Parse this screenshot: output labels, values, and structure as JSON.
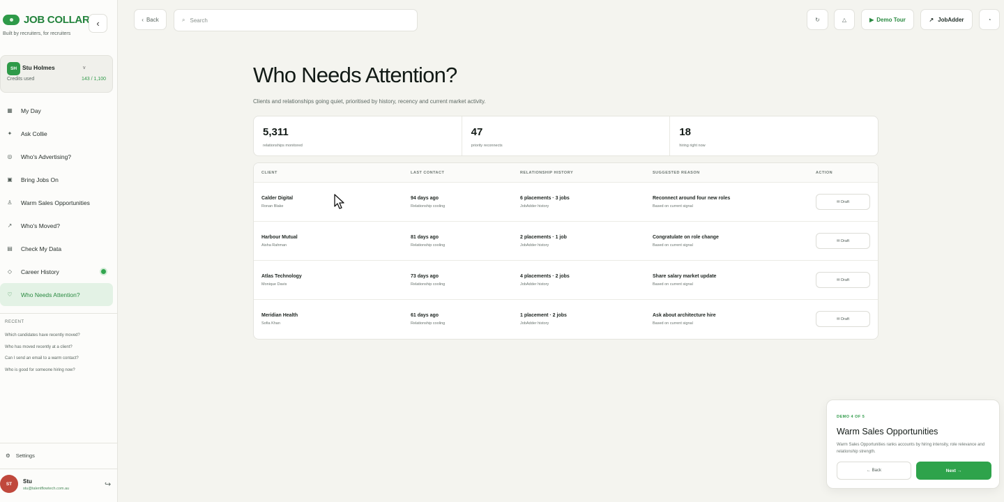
{
  "brand": {
    "name": "JOB COLLAR",
    "tagline": "Built by recruiters, for recruiters",
    "accent": "#2e9a48"
  },
  "user_card": {
    "initials": "SH",
    "name": "Stu Holmes",
    "credits_label": "Credits used",
    "credits_value": "143 / 1,100"
  },
  "sidebar": {
    "items": [
      {
        "label": "My Day",
        "icon": "grid-icon"
      },
      {
        "label": "Ask Collie",
        "icon": "sparkle-icon"
      },
      {
        "label": "Who's Advertising?",
        "icon": "target-icon"
      },
      {
        "label": "Bring Jobs On",
        "icon": "square-icon"
      },
      {
        "label": "Warm Sales Opportunities",
        "icon": "person-icon"
      },
      {
        "label": "Who's Moved?",
        "icon": "arrow-icon"
      },
      {
        "label": "Check My Data",
        "icon": "table-icon"
      },
      {
        "label": "Career History",
        "icon": "diamond-icon"
      },
      {
        "label": "Who Needs Attention?",
        "icon": "heart-icon"
      }
    ],
    "recent_title": "RECENT",
    "recent": [
      "Which candidates have recently moved?",
      "Who has moved recently at a client?",
      "Can I send an email to a warm contact?",
      "Who is good for someone hiring now?"
    ],
    "settings_label": "Settings"
  },
  "profile": {
    "initials": "ST",
    "name": "Stu",
    "email": "stu@talentflowtech.com.au"
  },
  "topbar": {
    "back_label": "Back",
    "search_placeholder": "Search",
    "demo_tour_label": "Demo Tour",
    "jobadder_label": "JobAdder"
  },
  "page": {
    "title": "Who Needs Attention?",
    "subtitle": "Clients and relationships going quiet, prioritised by history, recency and current market activity."
  },
  "stats": [
    {
      "value": "5,311",
      "label": "relationships monitored"
    },
    {
      "value": "47",
      "label": "priority reconnects"
    },
    {
      "value": "18",
      "label": "hiring right now"
    }
  ],
  "table": {
    "headers": [
      "CLIENT",
      "LAST CONTACT",
      "RELATIONSHIP HISTORY",
      "SUGGESTED REASON",
      "ACTION"
    ],
    "rows": [
      {
        "client": "Calder Digital",
        "contact": "Ronan Blake",
        "last": "94 days ago",
        "last_sub": "Relationship cooling",
        "history": "6 placements · 3 jobs",
        "history_sub": "JobAdder history",
        "reason": "Reconnect around four new roles",
        "reason_sub": "Based on current signal",
        "action": "Draft"
      },
      {
        "client": "Harbour Mutual",
        "contact": "Aisha Rahman",
        "last": "81 days ago",
        "last_sub": "Relationship cooling",
        "history": "2 placements · 1 job",
        "history_sub": "JobAdder history",
        "reason": "Congratulate on role change",
        "reason_sub": "Based on current signal",
        "action": "Draft"
      },
      {
        "client": "Atlas Technology",
        "contact": "Monique Davis",
        "last": "73 days ago",
        "last_sub": "Relationship cooling",
        "history": "4 placements · 2 jobs",
        "history_sub": "JobAdder history",
        "reason": "Share salary market update",
        "reason_sub": "Based on current signal",
        "action": "Draft"
      },
      {
        "client": "Meridian Health",
        "contact": "Sofia Khan",
        "last": "61 days ago",
        "last_sub": "Relationship cooling",
        "history": "1 placement · 2 jobs",
        "history_sub": "JobAdder history",
        "reason": "Ask about architecture hire",
        "reason_sub": "Based on current signal",
        "action": "Draft"
      }
    ]
  },
  "demo": {
    "step": "DEMO 4 OF 5",
    "title": "Warm Sales Opportunities",
    "description": "Warm Sales Opportunities ranks accounts by hiring intensity, role relevance and relationship strength.",
    "back_label": "← Back",
    "next_label": "Next →"
  }
}
